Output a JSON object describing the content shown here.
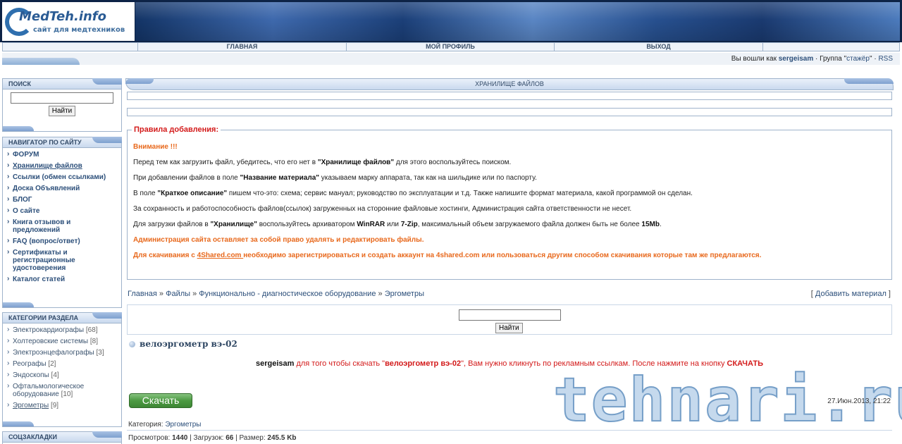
{
  "site": {
    "logo_title": "MedTeh.info",
    "logo_subtitle": "сайт для медтехников"
  },
  "nav": [
    {
      "label": ""
    },
    {
      "label": "ГЛАВНАЯ"
    },
    {
      "label": "МОЙ ПРОФИЛЬ"
    },
    {
      "label": "ВЫХОД"
    },
    {
      "label": ""
    }
  ],
  "user_bar": {
    "prefix": "Вы вошли как",
    "username": "sergeisam",
    "group_prefix": "· Группа \"",
    "group": "стажёр",
    "group_suffix": "\" ·",
    "rss": "RSS"
  },
  "search_block": {
    "title": "ПОИСК",
    "button": "Найти",
    "input_value": ""
  },
  "navigator": {
    "title": "НАВИГАТОР ПО САЙТУ",
    "items": [
      {
        "label": "ФОРУМ"
      },
      {
        "label": "Хранилище файлов"
      },
      {
        "label": "Ссылки (обмен ссылками)"
      },
      {
        "label": "Доска Объявлений"
      },
      {
        "label": "БЛОГ"
      },
      {
        "label": "О сайте"
      },
      {
        "label": "Книга отзывов и предложений"
      },
      {
        "label": "FAQ (вопрос/ответ)"
      },
      {
        "label": "Сертификаты и регистрационные удостоверения"
      },
      {
        "label": "Каталог статей"
      }
    ]
  },
  "categories": {
    "title": "КАТЕГОРИИ РАЗДЕЛА",
    "items": [
      {
        "name": "Электрокардиографы",
        "count": "[68]"
      },
      {
        "name": "Холтеровские системы",
        "count": "[8]"
      },
      {
        "name": "Электроэнцефалографы",
        "count": "[3]"
      },
      {
        "name": "Реографы",
        "count": "[2]"
      },
      {
        "name": "Эндоскопы",
        "count": "[4]"
      },
      {
        "name": "Офтальмологическое оборудование",
        "count": "[10]"
      },
      {
        "name": "Эргометры",
        "count": "[9]"
      }
    ]
  },
  "bookmarks": {
    "title": "СОЦЗАКЛАДКИ"
  },
  "main": {
    "title": "ХРАНИЛИЩЕ ФАЙЛОВ",
    "rules_title": "Правила добавления:",
    "rules": {
      "attention": "Внимание !!!",
      "p1a": "Перед тем как загрузить файл, убедитесь, что его нет в ",
      "p1b": "\"Хранилище файлов\"",
      "p1c": " для этого воспользуйтесь поиском.",
      "p2a": "При добавлении файлов в поле ",
      "p2b": "\"Название материала\"",
      "p2c": " указываем марку аппарата, так как на шильдике или по паспорту.",
      "p3a": "В поле ",
      "p3b": "\"Краткое описание\"",
      "p3c": " пишем что-это: схема; сервис мануал; руководство по эксплуатации и т.д. Также напишите формат материала, какой программой он сделан.",
      "p4": "За сохранность и работоспособность файлов(ссылок) загруженных на сторонние файловые хостинги, Администрация сайта ответственности не несет.",
      "p5a": "Для загрузки файлов в ",
      "p5b": "\"Хранилище\"",
      "p5c": " воспользуйтесь архиватором ",
      "p5d": "WinRAR",
      "p5e": " или ",
      "p5f": "7-Zip",
      "p5g": ", максимальный объем загружаемого файла должен быть не более ",
      "p5h": "15Mb",
      "p5i": ".",
      "p6": "Администрация сайта оставляет за собой право удалять и редактировать файлы.",
      "p7a": "Для скачивания с ",
      "p7b": "4Shared.com ",
      "p7c": "необходимо зарегистрироваться и создать аккаунт на 4shared.com или пользоваться другим способом скачивания которые там же предлагаются."
    },
    "breadcrumb": [
      {
        "label": "Главная"
      },
      {
        "label": "Файлы"
      },
      {
        "label": "Функционально - диагностическое оборудование"
      },
      {
        "label": "Эргометры"
      }
    ],
    "breadcrumb_sep": " » ",
    "add_material": "Добавить материал",
    "search_button": "Найти",
    "entry": {
      "title": "велоэргометр вэ-02",
      "note_user": "sergeisam",
      "note_a": " для того чтобы скачать \"",
      "note_b": "велоэргометр вэ-02",
      "note_c": "\", Вам нужно кликнуть по рекламным ссылкам. После нажмите на кнопку ",
      "note_d": "СКАЧАТЬ",
      "download_label": "Скачать",
      "watermark": "tehnari.ru",
      "date": "27.Июн.2013, 21:22",
      "category_label": "Категория:",
      "category": "Эргометры",
      "views_label": "Просмотров:",
      "views": "1440",
      "downloads_label": "Загрузок:",
      "downloads": "66",
      "size_label": "Размер:",
      "size": "245.5 Kb"
    }
  }
}
